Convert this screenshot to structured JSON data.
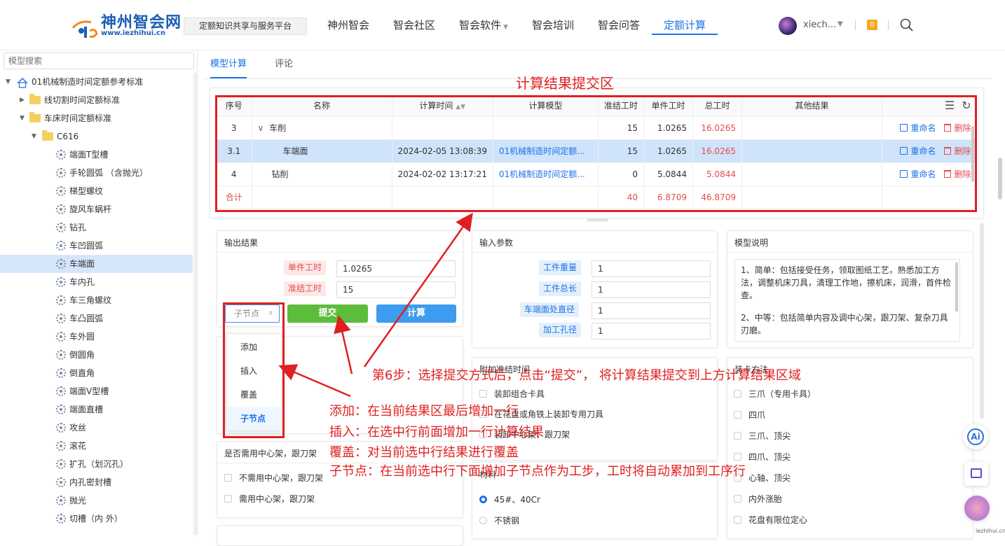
{
  "header": {
    "logo_cn": "神州智会网",
    "logo_url": "www.iezhihui.cn",
    "slogan": "定额知识共享与服务平台",
    "nav": [
      {
        "label": "神州智会"
      },
      {
        "label": "智会社区"
      },
      {
        "label": "智会软件"
      },
      {
        "label": "智会培训"
      },
      {
        "label": "智会问答"
      },
      {
        "label": "定额计算"
      }
    ],
    "active_nav": "定额计算",
    "username": "xiech...",
    "badge": "0",
    "accent_color": "#1a73e8"
  },
  "sidebar": {
    "search_placeholder": "模型搜索",
    "tree": [
      {
        "label": "01机械制造时间定额参考标准",
        "kind": "root"
      },
      {
        "label": "线切割时间定额标准",
        "kind": "folder"
      },
      {
        "label": "车床时间定额标准",
        "kind": "folder"
      },
      {
        "label": "C616",
        "kind": "folder"
      },
      {
        "label": "端面T型槽",
        "kind": "model"
      },
      {
        "label": "手轮圆弧 （含抛光）",
        "kind": "model"
      },
      {
        "label": "梯型螺纹",
        "kind": "model"
      },
      {
        "label": "旋风车蜗杆",
        "kind": "model"
      },
      {
        "label": "钻孔",
        "kind": "model"
      },
      {
        "label": "车凹圆弧",
        "kind": "model"
      },
      {
        "label": "车端面",
        "kind": "model",
        "selected": true
      },
      {
        "label": "车内孔",
        "kind": "model"
      },
      {
        "label": "车三角螺纹",
        "kind": "model"
      },
      {
        "label": "车凸圆弧",
        "kind": "model"
      },
      {
        "label": "车外圆",
        "kind": "model"
      },
      {
        "label": "倒圆角",
        "kind": "model"
      },
      {
        "label": "倒直角",
        "kind": "model"
      },
      {
        "label": "端面V型槽",
        "kind": "model"
      },
      {
        "label": "端面直槽",
        "kind": "model"
      },
      {
        "label": "攻丝",
        "kind": "model"
      },
      {
        "label": "滚花",
        "kind": "model"
      },
      {
        "label": "扩孔（划沉孔）",
        "kind": "model"
      },
      {
        "label": "内孔密封槽",
        "kind": "model"
      },
      {
        "label": "抛光",
        "kind": "model"
      },
      {
        "label": "切槽（内 外）",
        "kind": "model"
      }
    ]
  },
  "tabs": [
    {
      "label": "模型计算"
    },
    {
      "label": "评论"
    }
  ],
  "results": {
    "columns": [
      "序号",
      "名称",
      "计算时间",
      "计算模型",
      "准结工时",
      "单件工时",
      "总工时",
      "其他结果"
    ],
    "rows": [
      {
        "no": "3",
        "name": "车削",
        "time": "",
        "model": "",
        "prep": "15",
        "unit": "1.0265",
        "total": "16.0265",
        "rename": "重命名",
        "delete": "删除"
      },
      {
        "no": "3.1",
        "name": "车端面",
        "time": "2024-02-05 13:08:39",
        "model": "01机械制造时间定额...",
        "prep": "15",
        "unit": "1.0265",
        "total": "16.0265",
        "rename": "重命名",
        "delete": "删除"
      },
      {
        "no": "4",
        "name": "钻削",
        "time": "2024-02-02 13:17:21",
        "model": "01机械制造时间定额...",
        "prep": "0",
        "unit": "5.0844",
        "total": "5.0844",
        "rename": "重命名",
        "delete": "删除"
      }
    ],
    "sum": {
      "label": "合计",
      "prep": "40",
      "unit": "6.8709",
      "total": "46.8709"
    }
  },
  "output": {
    "title": "输出结果",
    "unit_label": "单件工时",
    "unit_value": "1.0265",
    "prep_label": "准结工时",
    "prep_value": "15",
    "mode_value": "子节点",
    "submit": "提交",
    "calc": "计算",
    "dropdown": [
      "添加",
      "插入",
      "覆盖",
      "子节点"
    ]
  },
  "input_params": {
    "title": "输入参数",
    "fields": [
      {
        "label": "工件重量",
        "value": "1"
      },
      {
        "label": "工件总长",
        "value": "1"
      },
      {
        "label": "车端面处直径",
        "value": "1"
      },
      {
        "label": "加工孔径",
        "value": "1"
      }
    ]
  },
  "model_desc": {
    "title": "模型说明",
    "paragraphs": [
      "1、简单：包括接受任务，领取图纸工艺，熟悉加工方法，调整机床刀具，清理工作地，擦机床，润滑，首件检查。",
      "2、中等：包括简单内容及调中心架，跟刀架、复杂刀具刃磨。"
    ]
  },
  "extra_prep": {
    "title": "附加准结时间",
    "options": [
      "装卸组合卡具",
      "在花盘或角铁上装卸专用刀具",
      "装卸中心架，跟刀架"
    ]
  },
  "clamp": {
    "title": "装卡方法",
    "options": [
      "三爪（专用卡具）",
      "四爪",
      "三爪、顶尖",
      "四爪、顶尖",
      "心轴、顶尖",
      "内外涨胎",
      "花盘有限位定心"
    ]
  },
  "center_rest": {
    "title": "是否需用中心架，跟刀架",
    "options": [
      "不需用中心架，跟刀架",
      "需用中心架，跟刀架"
    ]
  },
  "material": {
    "title": "材料",
    "options": [
      "45#、40Cr",
      "不锈钢"
    ]
  },
  "annotations": {
    "box_title": "计算结果提交区",
    "step6": "第6步：选择提交方式后，点击“提交”， 将计算结果提交到上方计算结果区域",
    "add": "添加：在当前结果区最后增加一行",
    "insert": "插入：在选中行前面增加一行计算结果",
    "cover": "覆盖：对当前选中行结果进行覆盖",
    "child": "子节点：在当前选中行下面增加子节点作为工步，工时将自动累加到工序行",
    "color": "#e02020"
  },
  "watermark": "iezhihui.cn",
  "ai_label": "Ai"
}
